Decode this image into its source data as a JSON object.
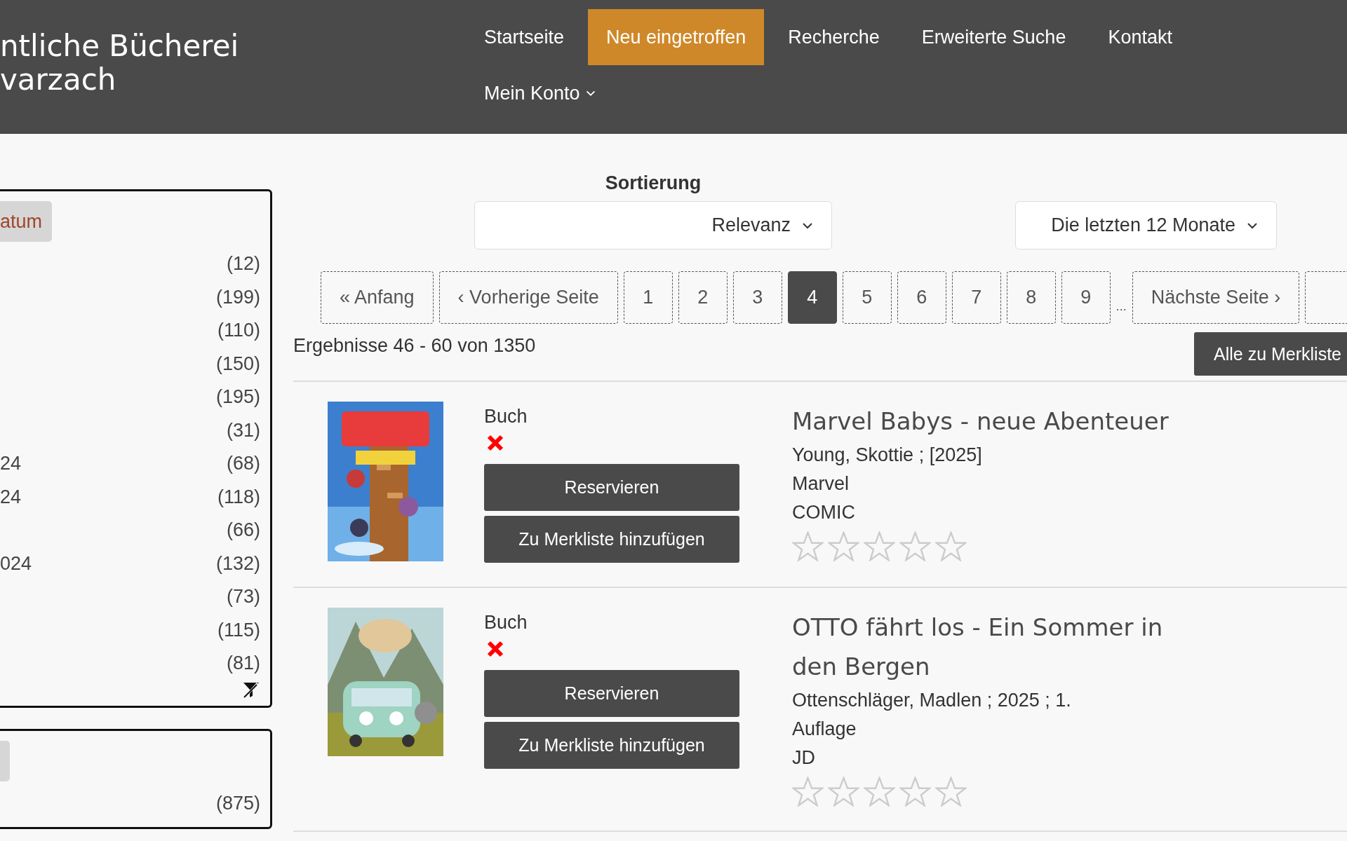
{
  "site_title": [
    "ntliche Bücherei",
    "varzach"
  ],
  "nav": [
    {
      "label": "Startseite",
      "selected": false
    },
    {
      "label": "Neu eingetroffen",
      "selected": true
    },
    {
      "label": "Recherche",
      "selected": false
    },
    {
      "label": "Erweiterte Suche",
      "selected": false
    },
    {
      "label": "Kontakt",
      "selected": false
    },
    {
      "label": "Mein Konto",
      "selected": false,
      "kind": "dropdown"
    }
  ],
  "facets": [
    {
      "chip": "atum",
      "clear_filter": true,
      "rows": [
        {
          "count": "(12)"
        },
        {
          "count": "(199)"
        },
        {
          "count": "(110)"
        },
        {
          "count": "(150)"
        },
        {
          "count": "(195)"
        },
        {
          "count": "(31)"
        },
        {
          "label": "24",
          "count": "(68)"
        },
        {
          "label": "24",
          "count": "(118)"
        },
        {
          "count": "(66)"
        },
        {
          "label": "024",
          "count": "(132)"
        },
        {
          "count": "(73)"
        },
        {
          "count": "(115)"
        },
        {
          "count": "(81)"
        }
      ]
    },
    {
      "clear_filter": false,
      "rows": [
        {
          "count": "(875)"
        }
      ]
    }
  ],
  "sort": {
    "label": "Sortierung",
    "value": "Relevanz"
  },
  "period": {
    "value": "Die letzten 12 Monate"
  },
  "pagination": [
    {
      "kind": "page",
      "label": "« Anfang",
      "selected": false
    },
    {
      "kind": "page",
      "label": "‹ Vorherige Seite",
      "selected": false
    },
    {
      "kind": "page",
      "label": "1",
      "selected": false
    },
    {
      "kind": "page",
      "label": "2",
      "selected": false
    },
    {
      "kind": "page",
      "label": "3",
      "selected": false
    },
    {
      "kind": "page",
      "label": "4",
      "selected": true
    },
    {
      "kind": "page",
      "label": "5",
      "selected": false
    },
    {
      "kind": "page",
      "label": "6",
      "selected": false
    },
    {
      "kind": "page",
      "label": "7",
      "selected": false
    },
    {
      "kind": "page",
      "label": "8",
      "selected": false
    },
    {
      "kind": "page",
      "label": "9",
      "selected": false
    },
    {
      "kind": "ellipsis",
      "label": "..."
    },
    {
      "kind": "page",
      "label": "Nächste Seite ›",
      "selected": false
    },
    {
      "kind": "partial",
      "selected": false
    }
  ],
  "results_summary": "Ergebnisse 46 - 60 von 1350",
  "bulk_button": "Alle zu Merkliste",
  "results": [
    {
      "media_type": "Buch",
      "available": false,
      "buttons": [
        "Reservieren",
        "Zu Merkliste hinzufügen"
      ],
      "title": "Marvel Babys - neue Abenteuer",
      "details": [
        "Young, Skottie ; [2025]",
        "Marvel",
        "COMIC"
      ],
      "stars": 0
    },
    {
      "media_type": "Buch",
      "available": false,
      "buttons": [
        "Reservieren",
        "Zu Merkliste hinzufügen"
      ],
      "title": "OTTO fährt los - Ein Sommer in den Bergen",
      "details": [
        "Ottenschläger, Madlen ; 2025 ; 1. Auflage",
        "JD"
      ],
      "stars": 0
    }
  ]
}
